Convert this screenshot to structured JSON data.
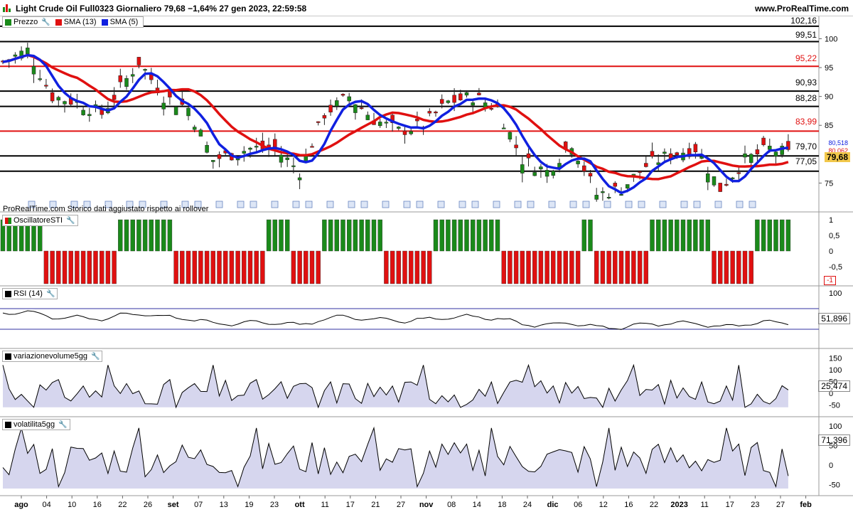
{
  "header": {
    "title": "Light Crude Oil Full0323 Giornaliero 79,68 −1,64% 27 gen 2023, 22:59:58",
    "brand": "www.ProRealTime.com"
  },
  "price_panel": {
    "legend": [
      {
        "label": "Prezzo",
        "color": "#1a8a1a"
      },
      {
        "label": "SMA (13)",
        "color": "#e01010"
      },
      {
        "label": "SMA (5)",
        "color": "#1020e0"
      }
    ],
    "caption": "ProRealTime.com  Storico dati aggiustato rispetto ai rollover",
    "levels": [
      {
        "value": "102,16",
        "color": "#000000"
      },
      {
        "value": "99,51",
        "color": "#000000"
      },
      {
        "value": "95,22",
        "color": "#e01010"
      },
      {
        "value": "90,93",
        "color": "#000000"
      },
      {
        "value": "88,28",
        "color": "#000000"
      },
      {
        "value": "83,99",
        "color": "#e01010"
      },
      {
        "value": "79,70",
        "color": "#000000"
      },
      {
        "value": "77,05",
        "color": "#000000"
      }
    ],
    "axis_ticks": [
      "100",
      "95",
      "90",
      "85",
      "75"
    ],
    "last_price": "79,68",
    "sma_values": {
      "blue": "80,518",
      "red": "80,062"
    }
  },
  "osc_panel": {
    "legend": "OscillatoreSTI",
    "axis_ticks": [
      "1",
      "0,5",
      "0",
      "-0,5"
    ],
    "last_value": "-1"
  },
  "rsi_panel": {
    "legend": "RSI (14)",
    "axis_ticks": [
      "100"
    ],
    "last_value": "51,896"
  },
  "vol_panel": {
    "legend": "variazionevolume5gg",
    "axis_ticks": [
      "150",
      "100",
      "50",
      "0",
      "-50"
    ],
    "last_value": "25,474"
  },
  "volat_panel": {
    "legend": "volatilita5gg",
    "axis_ticks": [
      "100",
      "50",
      "0",
      "-50"
    ],
    "last_value": "71,396"
  },
  "x_axis": [
    "ago",
    "04",
    "10",
    "16",
    "22",
    "26",
    "set",
    "07",
    "13",
    "19",
    "23",
    "ott",
    "11",
    "17",
    "21",
    "27",
    "nov",
    "08",
    "14",
    "18",
    "24",
    "dic",
    "06",
    "12",
    "16",
    "22",
    "2023",
    "11",
    "17",
    "23",
    "27",
    "feb"
  ],
  "colors": {
    "up": "#1a8a1a",
    "down": "#e01010",
    "sma13": "#e01010",
    "sma5": "#1020e0",
    "fill": "#d6d6ee",
    "pricebox": "#f2c84b"
  }
}
